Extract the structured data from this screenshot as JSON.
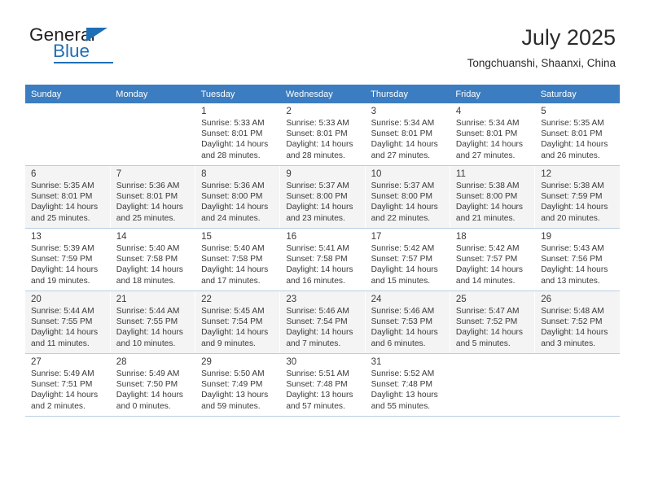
{
  "brand": {
    "name_top": "General",
    "name_bottom": "Blue",
    "accent_color": "#1f6fb5"
  },
  "header": {
    "title": "July 2025",
    "subtitle": "Tongchuanshi, Shaanxi, China"
  },
  "theme": {
    "header_row_bg": "#3b7dc0",
    "header_row_text": "#ffffff",
    "shaded_row_bg": "#f4f4f4",
    "grid_line": "#b9cde4"
  },
  "weekdays": [
    "Sunday",
    "Monday",
    "Tuesday",
    "Wednesday",
    "Thursday",
    "Friday",
    "Saturday"
  ],
  "labels": {
    "sunrise": "Sunrise:",
    "sunset": "Sunset:",
    "daylight": "Daylight:"
  },
  "weeks": [
    {
      "shaded": false,
      "days": [
        {
          "day": "",
          "sunrise": "",
          "sunset": "",
          "daylight_a": "",
          "daylight_b": ""
        },
        {
          "day": "",
          "sunrise": "",
          "sunset": "",
          "daylight_a": "",
          "daylight_b": ""
        },
        {
          "day": "1",
          "sunrise": "Sunrise: 5:33 AM",
          "sunset": "Sunset: 8:01 PM",
          "daylight_a": "Daylight: 14 hours",
          "daylight_b": "and 28 minutes."
        },
        {
          "day": "2",
          "sunrise": "Sunrise: 5:33 AM",
          "sunset": "Sunset: 8:01 PM",
          "daylight_a": "Daylight: 14 hours",
          "daylight_b": "and 28 minutes."
        },
        {
          "day": "3",
          "sunrise": "Sunrise: 5:34 AM",
          "sunset": "Sunset: 8:01 PM",
          "daylight_a": "Daylight: 14 hours",
          "daylight_b": "and 27 minutes."
        },
        {
          "day": "4",
          "sunrise": "Sunrise: 5:34 AM",
          "sunset": "Sunset: 8:01 PM",
          "daylight_a": "Daylight: 14 hours",
          "daylight_b": "and 27 minutes."
        },
        {
          "day": "5",
          "sunrise": "Sunrise: 5:35 AM",
          "sunset": "Sunset: 8:01 PM",
          "daylight_a": "Daylight: 14 hours",
          "daylight_b": "and 26 minutes."
        }
      ]
    },
    {
      "shaded": true,
      "days": [
        {
          "day": "6",
          "sunrise": "Sunrise: 5:35 AM",
          "sunset": "Sunset: 8:01 PM",
          "daylight_a": "Daylight: 14 hours",
          "daylight_b": "and 25 minutes."
        },
        {
          "day": "7",
          "sunrise": "Sunrise: 5:36 AM",
          "sunset": "Sunset: 8:01 PM",
          "daylight_a": "Daylight: 14 hours",
          "daylight_b": "and 25 minutes."
        },
        {
          "day": "8",
          "sunrise": "Sunrise: 5:36 AM",
          "sunset": "Sunset: 8:00 PM",
          "daylight_a": "Daylight: 14 hours",
          "daylight_b": "and 24 minutes."
        },
        {
          "day": "9",
          "sunrise": "Sunrise: 5:37 AM",
          "sunset": "Sunset: 8:00 PM",
          "daylight_a": "Daylight: 14 hours",
          "daylight_b": "and 23 minutes."
        },
        {
          "day": "10",
          "sunrise": "Sunrise: 5:37 AM",
          "sunset": "Sunset: 8:00 PM",
          "daylight_a": "Daylight: 14 hours",
          "daylight_b": "and 22 minutes."
        },
        {
          "day": "11",
          "sunrise": "Sunrise: 5:38 AM",
          "sunset": "Sunset: 8:00 PM",
          "daylight_a": "Daylight: 14 hours",
          "daylight_b": "and 21 minutes."
        },
        {
          "day": "12",
          "sunrise": "Sunrise: 5:38 AM",
          "sunset": "Sunset: 7:59 PM",
          "daylight_a": "Daylight: 14 hours",
          "daylight_b": "and 20 minutes."
        }
      ]
    },
    {
      "shaded": false,
      "days": [
        {
          "day": "13",
          "sunrise": "Sunrise: 5:39 AM",
          "sunset": "Sunset: 7:59 PM",
          "daylight_a": "Daylight: 14 hours",
          "daylight_b": "and 19 minutes."
        },
        {
          "day": "14",
          "sunrise": "Sunrise: 5:40 AM",
          "sunset": "Sunset: 7:58 PM",
          "daylight_a": "Daylight: 14 hours",
          "daylight_b": "and 18 minutes."
        },
        {
          "day": "15",
          "sunrise": "Sunrise: 5:40 AM",
          "sunset": "Sunset: 7:58 PM",
          "daylight_a": "Daylight: 14 hours",
          "daylight_b": "and 17 minutes."
        },
        {
          "day": "16",
          "sunrise": "Sunrise: 5:41 AM",
          "sunset": "Sunset: 7:58 PM",
          "daylight_a": "Daylight: 14 hours",
          "daylight_b": "and 16 minutes."
        },
        {
          "day": "17",
          "sunrise": "Sunrise: 5:42 AM",
          "sunset": "Sunset: 7:57 PM",
          "daylight_a": "Daylight: 14 hours",
          "daylight_b": "and 15 minutes."
        },
        {
          "day": "18",
          "sunrise": "Sunrise: 5:42 AM",
          "sunset": "Sunset: 7:57 PM",
          "daylight_a": "Daylight: 14 hours",
          "daylight_b": "and 14 minutes."
        },
        {
          "day": "19",
          "sunrise": "Sunrise: 5:43 AM",
          "sunset": "Sunset: 7:56 PM",
          "daylight_a": "Daylight: 14 hours",
          "daylight_b": "and 13 minutes."
        }
      ]
    },
    {
      "shaded": true,
      "days": [
        {
          "day": "20",
          "sunrise": "Sunrise: 5:44 AM",
          "sunset": "Sunset: 7:55 PM",
          "daylight_a": "Daylight: 14 hours",
          "daylight_b": "and 11 minutes."
        },
        {
          "day": "21",
          "sunrise": "Sunrise: 5:44 AM",
          "sunset": "Sunset: 7:55 PM",
          "daylight_a": "Daylight: 14 hours",
          "daylight_b": "and 10 minutes."
        },
        {
          "day": "22",
          "sunrise": "Sunrise: 5:45 AM",
          "sunset": "Sunset: 7:54 PM",
          "daylight_a": "Daylight: 14 hours",
          "daylight_b": "and 9 minutes."
        },
        {
          "day": "23",
          "sunrise": "Sunrise: 5:46 AM",
          "sunset": "Sunset: 7:54 PM",
          "daylight_a": "Daylight: 14 hours",
          "daylight_b": "and 7 minutes."
        },
        {
          "day": "24",
          "sunrise": "Sunrise: 5:46 AM",
          "sunset": "Sunset: 7:53 PM",
          "daylight_a": "Daylight: 14 hours",
          "daylight_b": "and 6 minutes."
        },
        {
          "day": "25",
          "sunrise": "Sunrise: 5:47 AM",
          "sunset": "Sunset: 7:52 PM",
          "daylight_a": "Daylight: 14 hours",
          "daylight_b": "and 5 minutes."
        },
        {
          "day": "26",
          "sunrise": "Sunrise: 5:48 AM",
          "sunset": "Sunset: 7:52 PM",
          "daylight_a": "Daylight: 14 hours",
          "daylight_b": "and 3 minutes."
        }
      ]
    },
    {
      "shaded": false,
      "days": [
        {
          "day": "27",
          "sunrise": "Sunrise: 5:49 AM",
          "sunset": "Sunset: 7:51 PM",
          "daylight_a": "Daylight: 14 hours",
          "daylight_b": "and 2 minutes."
        },
        {
          "day": "28",
          "sunrise": "Sunrise: 5:49 AM",
          "sunset": "Sunset: 7:50 PM",
          "daylight_a": "Daylight: 14 hours",
          "daylight_b": "and 0 minutes."
        },
        {
          "day": "29",
          "sunrise": "Sunrise: 5:50 AM",
          "sunset": "Sunset: 7:49 PM",
          "daylight_a": "Daylight: 13 hours",
          "daylight_b": "and 59 minutes."
        },
        {
          "day": "30",
          "sunrise": "Sunrise: 5:51 AM",
          "sunset": "Sunset: 7:48 PM",
          "daylight_a": "Daylight: 13 hours",
          "daylight_b": "and 57 minutes."
        },
        {
          "day": "31",
          "sunrise": "Sunrise: 5:52 AM",
          "sunset": "Sunset: 7:48 PM",
          "daylight_a": "Daylight: 13 hours",
          "daylight_b": "and 55 minutes."
        },
        {
          "day": "",
          "sunrise": "",
          "sunset": "",
          "daylight_a": "",
          "daylight_b": ""
        },
        {
          "day": "",
          "sunrise": "",
          "sunset": "",
          "daylight_a": "",
          "daylight_b": ""
        }
      ]
    }
  ]
}
